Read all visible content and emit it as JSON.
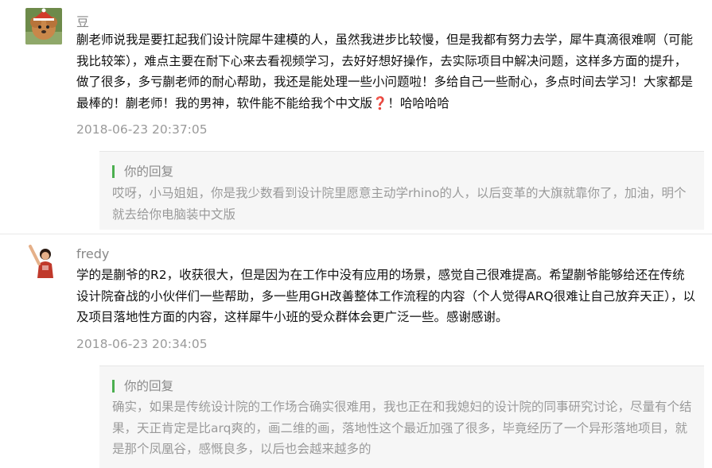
{
  "comments": [
    {
      "user": "豆",
      "text": "蒯老师说我是要扛起我们设计院犀牛建模的人，虽然我进步比较慢，但是我都有努力去学，犀牛真滴很难啊（可能我比较笨），难点主要在耐下心来去看视频学习，去好好想好操作，去实际项目中解决问题，这样多方面的提升，做了很多，多亏蒯老师的耐心帮助，我还是能处理一些小问题啦！多给自己一些耐心，多点时间去学习！大家都是最棒的！蒯老师！我的男神，软件能不能给我个中文版",
      "text_suffix": "！哈哈哈哈",
      "emoji": "❓",
      "time": "2018-06-23 20:37:05",
      "reply_label": "你的回复",
      "reply_text": "哎呀，小马姐姐，你是我少数看到设计院里愿意主动学rhino的人，以后变革的大旗就靠你了，加油，明个就去给你电脑装中文版"
    },
    {
      "user": "fredy",
      "text": "学的是蒯爷的R2，收获很大，但是因为在工作中没有应用的场景，感觉自己很难提高。希望蒯爷能够给还在传统设计院奋战的小伙伴们一些帮助，多一些用GH改善整体工作流程的内容（个人觉得ARQ很难让自己放弃天正），以及项目落地性方面的内容，这样犀牛小班的受众群体会更广泛一些。感谢感谢。",
      "time": "2018-06-23 20:34:05",
      "reply_label": "你的回复",
      "reply_text": "确实，如果是传统设计院的工作场合确实很难用，我也正在和我媳妇的设计院的同事研究讨论，尽量有个结果，天正肯定是比arq爽的，画二维的画，落地性这个最近加强了很多，毕竟经历了一个异形落地项目，就是那个凤凰谷，感慨良多，以后也会越来越多的"
    }
  ]
}
